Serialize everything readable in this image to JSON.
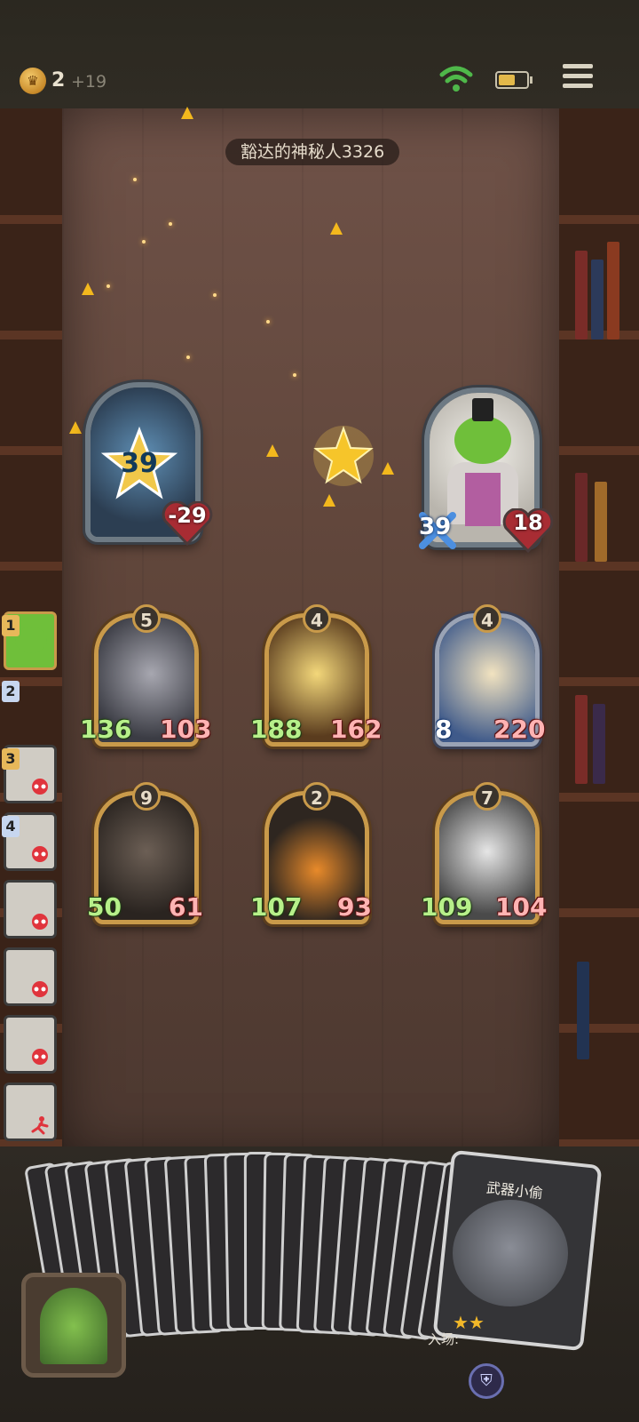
{
  "hud": {
    "coins": "2",
    "coin_income": "+19",
    "coin_icon": "crown-coin-icon",
    "wifi_icon": "wifi-icon",
    "battery_icon": "battery-icon",
    "menu_icon": "menu-icon"
  },
  "opponent": {
    "name": "豁达的神秘人3326"
  },
  "player_hero": {
    "armor": "39",
    "health": "-29"
  },
  "opponent_hero": {
    "attack": "39",
    "health": "18"
  },
  "board": {
    "row1": [
      {
        "level": "5",
        "attack": "136",
        "health": "103"
      },
      {
        "level": "4",
        "attack": "188",
        "health": "162"
      },
      {
        "level": "4",
        "attack": "8",
        "health": "220"
      }
    ],
    "row2": [
      {
        "level": "9",
        "attack": "50",
        "health": "61"
      },
      {
        "level": "2",
        "attack": "107",
        "health": "93"
      },
      {
        "level": "7",
        "attack": "109",
        "health": "104"
      }
    ]
  },
  "roster": [
    {
      "num": "1",
      "status": "active"
    },
    {
      "num": "2",
      "status": "waiting"
    },
    {
      "num": "3",
      "status": "eliminated"
    },
    {
      "num": "4",
      "status": "eliminated"
    },
    {
      "num": "",
      "status": "eliminated"
    },
    {
      "num": "",
      "status": "eliminated"
    },
    {
      "num": "",
      "status": "eliminated"
    },
    {
      "num": "",
      "status": "fled"
    }
  ],
  "hand": {
    "featured_card_name": "武器小偷",
    "enter_label": "入场:",
    "stars": 2
  },
  "colors": {
    "gold": "#c99a4a",
    "attack_green": "#b7f08a",
    "health_red": "#ffb3b3"
  }
}
